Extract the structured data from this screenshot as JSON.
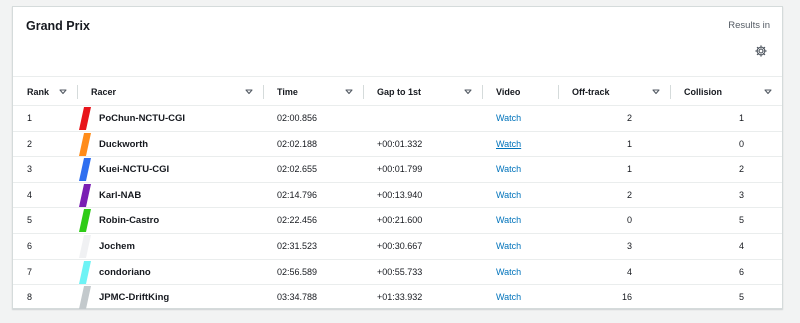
{
  "panel": {
    "title": "Grand Prix",
    "results_label": "Results in",
    "settings_icon": "gear-icon"
  },
  "columns": {
    "rank": "Rank",
    "racer": "Racer",
    "time": "Time",
    "gap": "Gap to 1st",
    "video": "Video",
    "offtrack": "Off-track",
    "collision": "Collision"
  },
  "rows": [
    {
      "rank": "1",
      "racer": "PoChun-NCTU-CGI",
      "color": "#e8151b",
      "time": "02:00.856",
      "gap": "",
      "video": "Watch",
      "offtrack": "2",
      "collision": "1"
    },
    {
      "rank": "2",
      "racer": "Duckworth",
      "color": "#ff8c1a",
      "time": "02:02.188",
      "gap": "+00:01.332",
      "video": "Watch",
      "offtrack": "1",
      "collision": "0"
    },
    {
      "rank": "3",
      "racer": "Kuei-NCTU-CGI",
      "color": "#2f6ff0",
      "time": "02:02.655",
      "gap": "+00:01.799",
      "video": "Watch",
      "offtrack": "1",
      "collision": "2"
    },
    {
      "rank": "4",
      "racer": "Karl-NAB",
      "color": "#7a1fb3",
      "time": "02:14.796",
      "gap": "+00:13.940",
      "video": "Watch",
      "offtrack": "2",
      "collision": "3"
    },
    {
      "rank": "5",
      "racer": "Robin-Castro",
      "color": "#2ecc17",
      "time": "02:22.456",
      "gap": "+00:21.600",
      "video": "Watch",
      "offtrack": "0",
      "collision": "5"
    },
    {
      "rank": "6",
      "racer": "Jochem",
      "color": "#f0f1f3",
      "time": "02:31.523",
      "gap": "+00:30.667",
      "video": "Watch",
      "offtrack": "3",
      "collision": "4"
    },
    {
      "rank": "7",
      "racer": "condoriano",
      "color": "#6ef3f5",
      "time": "02:56.589",
      "gap": "+00:55.733",
      "video": "Watch",
      "offtrack": "4",
      "collision": "6"
    },
    {
      "rank": "8",
      "racer": "JPMC-DriftKing",
      "color": "#c3c9cc",
      "time": "03:34.788",
      "gap": "+01:33.932",
      "video": "Watch",
      "offtrack": "16",
      "collision": "5"
    }
  ]
}
